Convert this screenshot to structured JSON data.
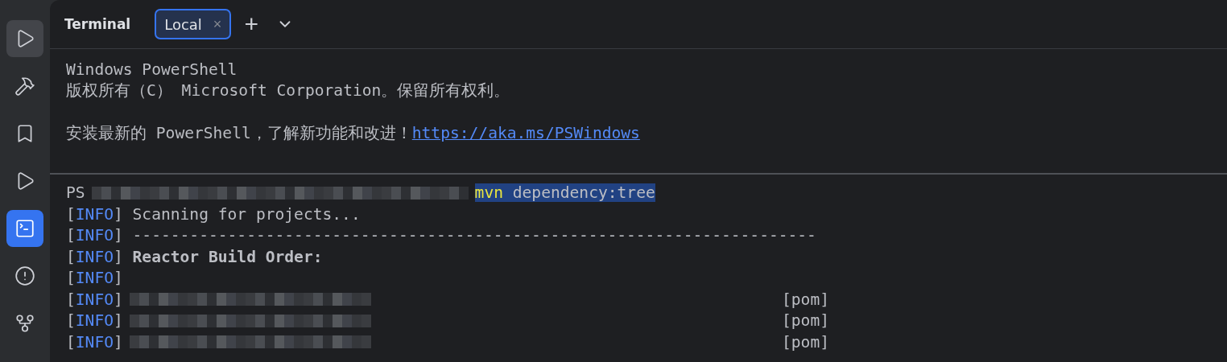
{
  "sidebar": {
    "items": [
      {
        "kind": "run",
        "selected": false,
        "highlighted": true
      },
      {
        "kind": "build",
        "selected": false,
        "highlighted": false
      },
      {
        "kind": "services",
        "selected": false,
        "highlighted": false
      },
      {
        "kind": "debug",
        "selected": false,
        "highlighted": false
      },
      {
        "kind": "terminal",
        "selected": true,
        "highlighted": false
      },
      {
        "kind": "problems",
        "selected": false,
        "highlighted": false
      },
      {
        "kind": "git",
        "selected": false,
        "highlighted": false
      }
    ]
  },
  "header": {
    "title": "Terminal",
    "tabs": [
      {
        "label": "Local",
        "selected": true,
        "close": "×"
      }
    ],
    "add_tab": "+"
  },
  "terminal": {
    "info_brackets": [
      "[",
      "]"
    ],
    "lines": [
      {
        "kind": "text",
        "text": "Windows PowerShell"
      },
      {
        "kind": "text",
        "text": "版权所有（C） Microsoft Corporation。保留所有权利。"
      },
      {
        "kind": "blank"
      },
      {
        "kind": "text_link",
        "text": "安装最新的 PowerShell，了解新功能和改进！",
        "link": "https://aka.ms/PSWindows"
      },
      {
        "kind": "blank"
      },
      {
        "kind": "separator"
      },
      {
        "kind": "prompt",
        "prefix": "PS",
        "path_redacted": true,
        "command": "mvn",
        "args": "dependency:tree",
        "selected": true
      },
      {
        "kind": "info",
        "tag": "INFO",
        "text": "Scanning for projects..."
      },
      {
        "kind": "info",
        "tag": "INFO",
        "text": "------------------------------------------------------------------------"
      },
      {
        "kind": "info",
        "tag": "INFO",
        "text": "Reactor Build Order:",
        "bold": true
      },
      {
        "kind": "info",
        "tag": "INFO"
      },
      {
        "kind": "module",
        "tag": "INFO",
        "name_redacted": true,
        "packaging": "[pom]"
      },
      {
        "kind": "module",
        "tag": "INFO",
        "name_redacted": true,
        "packaging": "[pom]"
      },
      {
        "kind": "module",
        "tag": "INFO",
        "name_redacted": true,
        "packaging": "[pom]"
      }
    ]
  }
}
